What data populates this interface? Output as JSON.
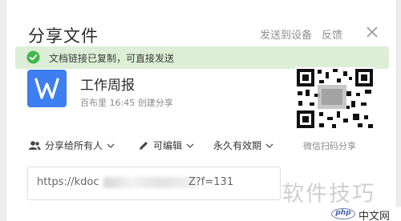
{
  "dialog": {
    "title": "分享文件",
    "header_links": {
      "send_to_device": "发送到设备",
      "feedback": "反馈"
    }
  },
  "toast": {
    "text": "文档链接已复制，可直接发送",
    "color": "#dcefd6",
    "icon": "check-circle-icon"
  },
  "file": {
    "icon_letter": "W",
    "icon_color": "#3d7ef0",
    "name": "工作周报",
    "meta": "百布里 16:45 创建分享"
  },
  "qr": {
    "label": "微信扫码分享"
  },
  "options": {
    "share_scope": "分享给所有人",
    "permission": "可编辑",
    "expiry": "永久有效期"
  },
  "link": {
    "prefix": "https://kdoc",
    "suffix": "Z?f=131"
  },
  "watermark": {
    "text": "软件技巧"
  },
  "badge": {
    "logo": "php",
    "site": "中文网"
  }
}
